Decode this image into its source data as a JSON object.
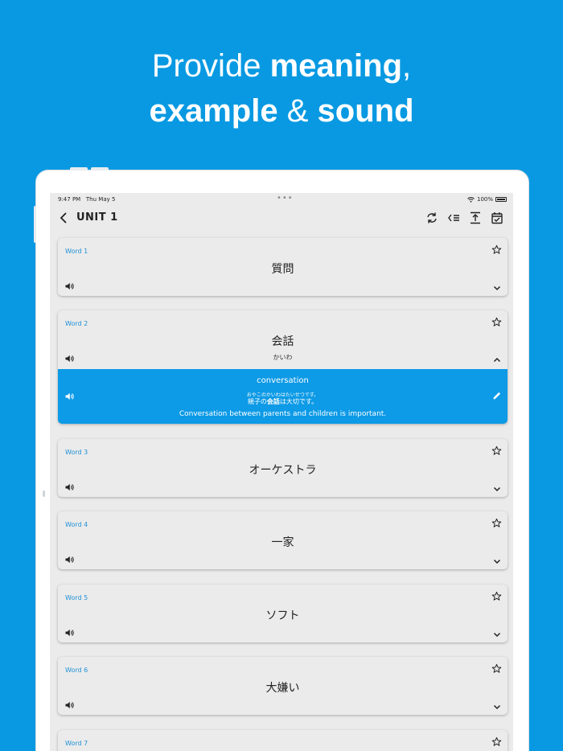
{
  "headline": {
    "line1_light": "Provide ",
    "line1_bold": "meaning",
    "line1_end": ",",
    "line2_bold1": "example",
    "line2_amp": " & ",
    "line2_bold2": "sound"
  },
  "status_bar": {
    "time": "9:47 PM",
    "date": "Thu May 5",
    "battery": "100%"
  },
  "nav": {
    "title": "UNIT 1"
  },
  "toolbar_icons": [
    "refresh-icon",
    "sort-list-icon",
    "expand-vertical-icon",
    "calendar-check-icon"
  ],
  "cards": [
    {
      "label": "Word 1",
      "word": "質問"
    },
    {
      "label": "Word 2",
      "word": "会話",
      "reading": "かいわ"
    },
    {
      "label": "Word 3",
      "word": "オーケストラ"
    },
    {
      "label": "Word 4",
      "word": "一家"
    },
    {
      "label": "Word 5",
      "word": "ソフト"
    },
    {
      "label": "Word 6",
      "word": "大嫌い"
    },
    {
      "label": "Word 7",
      "word": ""
    }
  ],
  "detail": {
    "meaning": "conversation",
    "furigana": "おやこのかいわはたいせつです。",
    "sentence_pre": "親子の",
    "sentence_bold": "会話",
    "sentence_post": "は大切です。",
    "translation": "Conversation between parents and children is important."
  },
  "colors": {
    "background": "#0899e2",
    "accent": "#0d9ae6",
    "label": "#1e90d6",
    "card": "#ebebeb"
  }
}
